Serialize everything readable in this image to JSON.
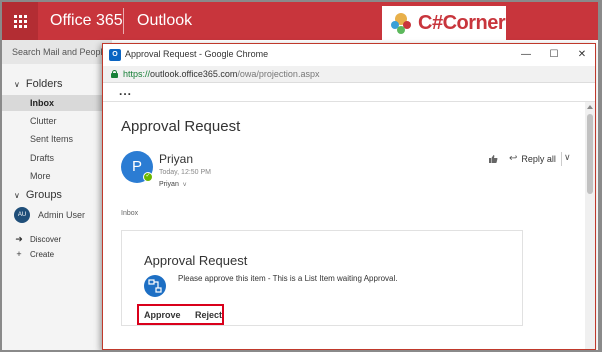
{
  "topbar": {
    "app_launcher_icon": "waffle-grid-icon",
    "suite_title": "Office 365",
    "app_title": "Outlook",
    "logo_text": "C#Corner"
  },
  "leftnav": {
    "search_placeholder": "Search Mail and People",
    "folders_heading": "Folders",
    "folders": [
      {
        "label": "Inbox",
        "active": true
      },
      {
        "label": "Clutter"
      },
      {
        "label": "Sent Items"
      },
      {
        "label": "Drafts"
      },
      {
        "label": "More"
      }
    ],
    "groups_heading": "Groups",
    "group": {
      "initials": "AU",
      "label": "Admin User"
    },
    "discover_label": "Discover",
    "create_label": "Create"
  },
  "popup": {
    "window_title": "Approval Request - Google Chrome",
    "app_icon_letter": "O",
    "url": {
      "scheme": "https://",
      "host": "outlook.office365.com",
      "path": "/owa/projection.aspx"
    },
    "more_label": "...",
    "window_controls": {
      "minimize": "—",
      "maximize": "☐",
      "close": "✕"
    }
  },
  "message": {
    "subject": "Approval Request",
    "sender_initial": "P",
    "sender_name": "Priyan",
    "sent_time": "Today, 12:50 PM",
    "recipient": "Priyan",
    "recipient_caret": "ⅴ",
    "reply_all_label": "Reply all",
    "folder_label": "Inbox"
  },
  "card": {
    "title": "Approval Request",
    "description": "Please approve this item - This is a List Item waiting Approval.",
    "approve_label": "Approve",
    "reject_label": "Reject",
    "highlight_color": "#d9001b"
  },
  "colors": {
    "office_red": "#c8353c",
    "accent_blue": "#2b7cd3",
    "presence_green": "#6bb700"
  }
}
